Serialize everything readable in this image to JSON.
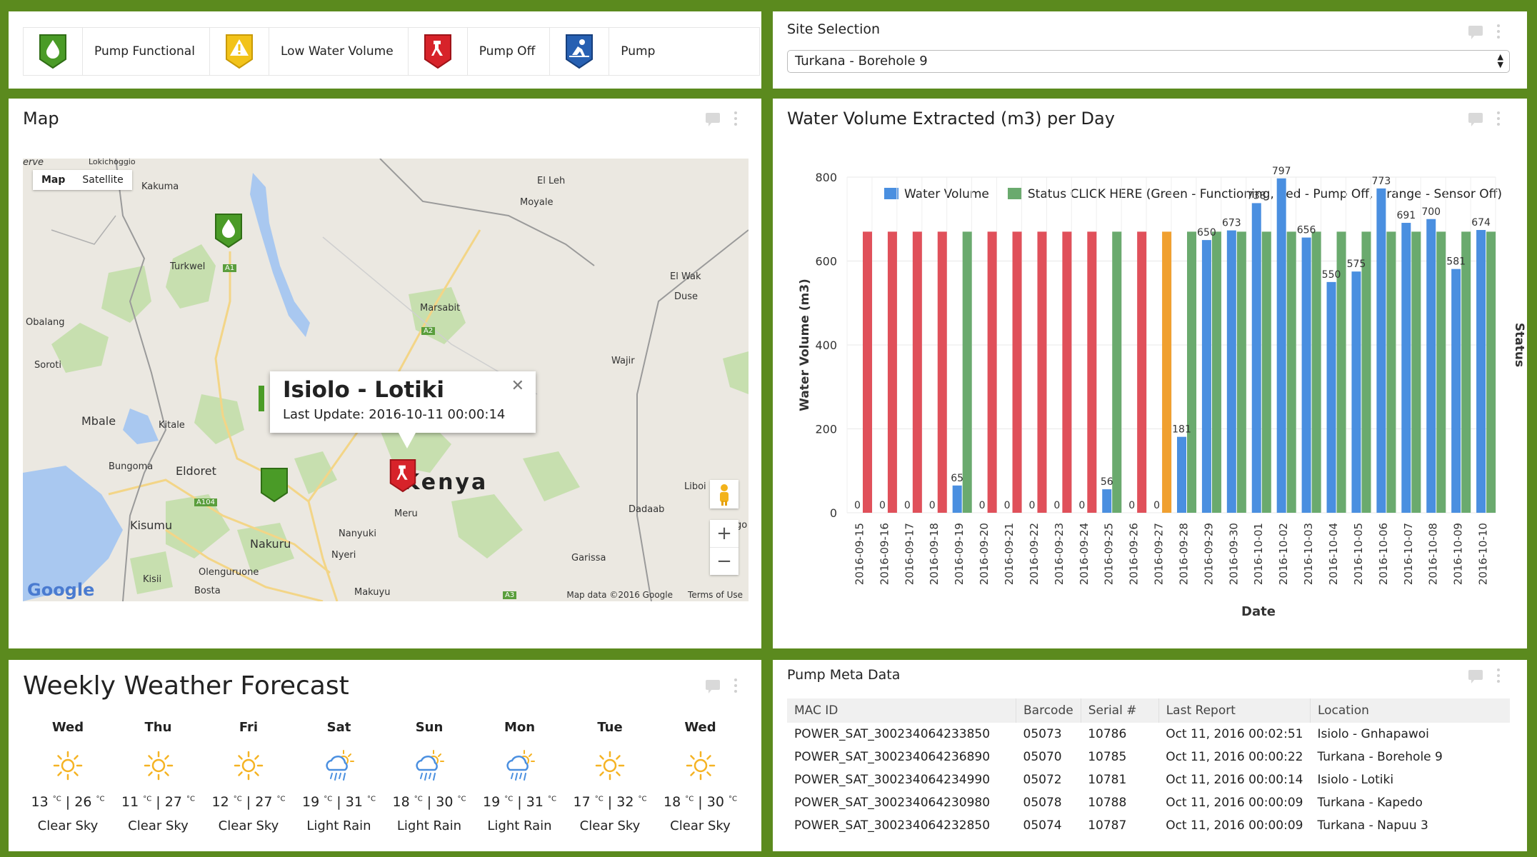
{
  "legend": {
    "items": [
      {
        "label": "Pump Functional",
        "icon": "pump-functional-icon",
        "color": "#4a9b27"
      },
      {
        "label": "Low Water Volume",
        "icon": "low-water-warning-icon",
        "color": "#f2c31a"
      },
      {
        "label": "Pump Off",
        "icon": "pump-off-icon",
        "color": "#d7232a"
      },
      {
        "label": "Pump",
        "icon": "pump-maintenance-icon",
        "color": "#2760b2"
      }
    ]
  },
  "site": {
    "title": "Site Selection",
    "selected": "Turkana - Borehole 9"
  },
  "map": {
    "title": "Map",
    "type_map": "Map",
    "type_satellite": "Satellite",
    "country": "Kenya",
    "places": [
      "erve",
      "Lokichoggio",
      "Kakuma",
      "El Leh",
      "Moyale",
      "Turkwel",
      "El Wak",
      "Duse",
      "Marsabit",
      "Obalang",
      "Soroti",
      "Wajir",
      "Mbale",
      "Kitale",
      "Bungoma",
      "Eldoret",
      "Liboi",
      "Kisumu",
      "Dadaab",
      "Meru",
      "Nanyuki",
      "Nakuru",
      "Nyeri",
      "Garissa",
      "Kisii",
      "Olenguruone",
      "Bosta",
      "Makuyu",
      "A1",
      "A2",
      "A104",
      "A3",
      "go"
    ],
    "popup_title": "Isiolo - Lotiki",
    "popup_update": "Last Update: 2016-10-11 00:00:14",
    "attribution": "Map data ©2016 Google",
    "terms": "Terms of Use",
    "logo": "Google"
  },
  "chart_panel": {
    "title": "Water Volume Extracted (m3) per Day"
  },
  "chart_data": {
    "type": "bar",
    "title": "Water Volume Extracted (m3) per Day",
    "xlabel": "Date",
    "ylabel": "Water Volume (m3)",
    "y2label": "Status",
    "ylim": [
      0,
      800
    ],
    "yticks": [
      0,
      200,
      400,
      600,
      800
    ],
    "legend_position": "top",
    "categories": [
      "2016-09-15",
      "2016-09-16",
      "2016-09-17",
      "2016-09-18",
      "2016-09-19",
      "2016-09-20",
      "2016-09-21",
      "2016-09-22",
      "2016-09-23",
      "2016-09-24",
      "2016-09-25",
      "2016-09-26",
      "2016-09-27",
      "2016-09-28",
      "2016-09-29",
      "2016-09-30",
      "2016-10-01",
      "2016-10-02",
      "2016-10-03",
      "2016-10-04",
      "2016-10-05",
      "2016-10-06",
      "2016-10-07",
      "2016-10-08",
      "2016-10-09",
      "2016-10-10"
    ],
    "series": [
      {
        "name": "Water Volume",
        "color": "#4a8fe0",
        "values": [
          0,
          0,
          0,
          0,
          65,
          0,
          0,
          0,
          0,
          0,
          56,
          0,
          0,
          181,
          650,
          673,
          738,
          797,
          656,
          550,
          575,
          773,
          691,
          700,
          581,
          674
        ]
      },
      {
        "name": "Status CLICK HERE (Green - Functioning, Red - Pump Off, Orange - Sensor Off)",
        "color": "#6aaa6e",
        "status": [
          "Pump Off",
          "Pump Off",
          "Pump Off",
          "Pump Off",
          "Functioning",
          "Pump Off",
          "Pump Off",
          "Pump Off",
          "Pump Off",
          "Pump Off",
          "Functioning",
          "Pump Off",
          "Sensor Off",
          "Functioning",
          "Functioning",
          "Functioning",
          "Functioning",
          "Functioning",
          "Functioning",
          "Functioning",
          "Functioning",
          "Functioning",
          "Functioning",
          "Functioning",
          "Functioning",
          "Functioning"
        ]
      }
    ],
    "status_colors": {
      "Functioning": "#6aaa6e",
      "Pump Off": "#e0505a",
      "Sensor Off": "#f0a030"
    }
  },
  "weather": {
    "title": "Weekly Weather Forecast",
    "days": [
      {
        "day": "Wed",
        "low": "13",
        "high": "26",
        "cond": "Clear Sky",
        "icon": "sun-icon"
      },
      {
        "day": "Thu",
        "low": "11",
        "high": "27",
        "cond": "Clear Sky",
        "icon": "sun-icon"
      },
      {
        "day": "Fri",
        "low": "12",
        "high": "27",
        "cond": "Clear Sky",
        "icon": "sun-icon"
      },
      {
        "day": "Sat",
        "low": "19",
        "high": "31",
        "cond": "Light Rain",
        "icon": "rain-icon"
      },
      {
        "day": "Sun",
        "low": "18",
        "high": "30",
        "cond": "Light Rain",
        "icon": "rain-icon"
      },
      {
        "day": "Mon",
        "low": "19",
        "high": "31",
        "cond": "Light Rain",
        "icon": "rain-icon"
      },
      {
        "day": "Tue",
        "low": "17",
        "high": "32",
        "cond": "Clear Sky",
        "icon": "sun-icon"
      },
      {
        "day": "Wed",
        "low": "18",
        "high": "30",
        "cond": "Clear Sky",
        "icon": "sun-icon"
      }
    ],
    "unit": "°C"
  },
  "meta": {
    "title": "Pump Meta Data",
    "headers": [
      "MAC ID",
      "Barcode",
      "Serial #",
      "Last Report",
      "Location"
    ],
    "rows": [
      [
        "POWER_SAT_300234064233850",
        "05073",
        "10786",
        "Oct 11, 2016 00:02:51",
        "Isiolo - Gnhapawoi"
      ],
      [
        "POWER_SAT_300234064236890",
        "05070",
        "10785",
        "Oct 11, 2016 00:00:22",
        "Turkana - Borehole 9"
      ],
      [
        "POWER_SAT_300234064234990",
        "05072",
        "10781",
        "Oct 11, 2016 00:00:14",
        "Isiolo - Lotiki"
      ],
      [
        "POWER_SAT_300234064230980",
        "05078",
        "10788",
        "Oct 11, 2016 00:00:09",
        "Turkana - Kapedo"
      ],
      [
        "POWER_SAT_300234064232850",
        "05074",
        "10787",
        "Oct 11, 2016 00:00:09",
        "Turkana - Napuu 3"
      ]
    ]
  }
}
